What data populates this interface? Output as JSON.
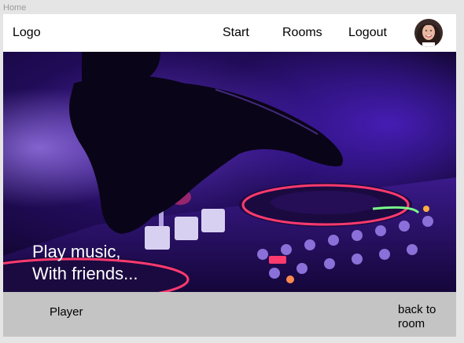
{
  "frame": {
    "label": "Home"
  },
  "navbar": {
    "logo": "Logo",
    "links": [
      {
        "label": "Start"
      },
      {
        "label": "Rooms"
      },
      {
        "label": "Logout"
      }
    ]
  },
  "hero": {
    "headline_line1": "Play music,",
    "headline_line2": "With friends...",
    "image": "dj-mixer-photo"
  },
  "footer": {
    "player_label": "Player",
    "back_button": "back to room"
  },
  "colors": {
    "frame_bg": "#e5e5e5",
    "navbar_bg": "#ffffff",
    "hero_purple": "#5a1fd0",
    "hero_pink": "#ff3a6e",
    "footer_bg": "#c4c4c4"
  }
}
